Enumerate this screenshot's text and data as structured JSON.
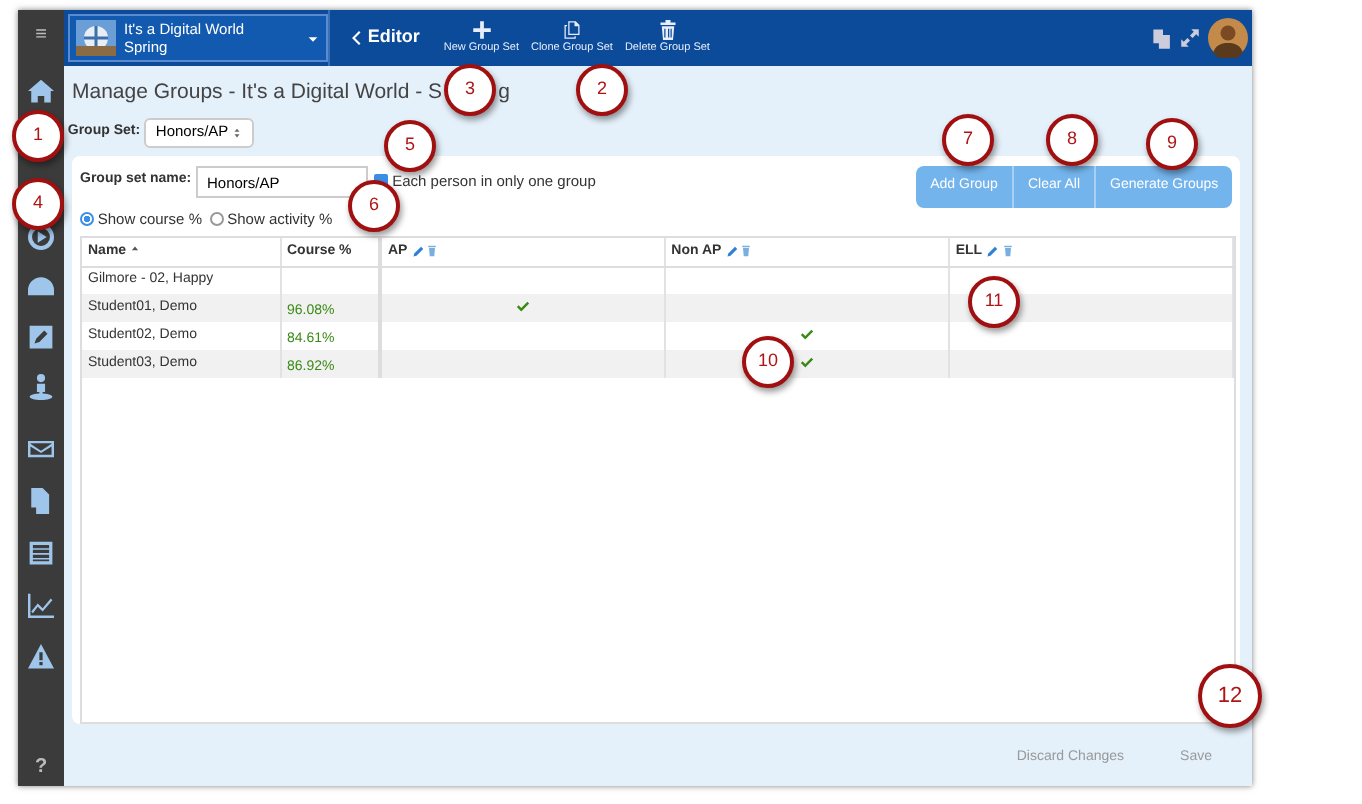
{
  "sidebar": {
    "menu_glyph": "≡",
    "help_glyph": "?"
  },
  "topbar": {
    "course_name": "It's a Digital World",
    "term": "Spring",
    "back_label": "Editor",
    "tools": [
      {
        "kind": "new",
        "label": "New Group Set"
      },
      {
        "kind": "clone",
        "label": "Clone Group Set"
      },
      {
        "kind": "delete",
        "label": "Delete Group Set"
      }
    ]
  },
  "page": {
    "title": "Manage Groups - It's a Digital World - S",
    "title_tail": "g"
  },
  "group_set": {
    "label": "Group Set:",
    "value": "Honors/AP"
  },
  "form": {
    "name_label": "Group set name:",
    "name_value": "Honors/AP",
    "one_group_label": "Each person in only one group",
    "one_group_checked": true
  },
  "actions": [
    "Add Group",
    "Clear All",
    "Generate Groups"
  ],
  "display": [
    {
      "label": "Show course %",
      "selected": true
    },
    {
      "label": "Show activity %",
      "selected": false
    }
  ],
  "table": {
    "columns": [
      "Name",
      "Course %"
    ],
    "groups": [
      "AP",
      "Non AP",
      "ELL"
    ],
    "rows": [
      {
        "name": "Gilmore - 02, Happy",
        "course": "",
        "groups": [
          false,
          false,
          false
        ]
      },
      {
        "name": "Student01, Demo",
        "course": "96.08%",
        "groups": [
          true,
          false,
          false
        ]
      },
      {
        "name": "Student02, Demo",
        "course": "84.61%",
        "groups": [
          false,
          true,
          false
        ]
      },
      {
        "name": "Student03, Demo",
        "course": "86.92%",
        "groups": [
          false,
          true,
          false
        ]
      }
    ]
  },
  "footer": [
    "Discard Changes",
    "Save"
  ],
  "callouts": [
    "1",
    "2",
    "3",
    "4",
    "5",
    "6",
    "7",
    "8",
    "9",
    "10",
    "11",
    "12"
  ]
}
